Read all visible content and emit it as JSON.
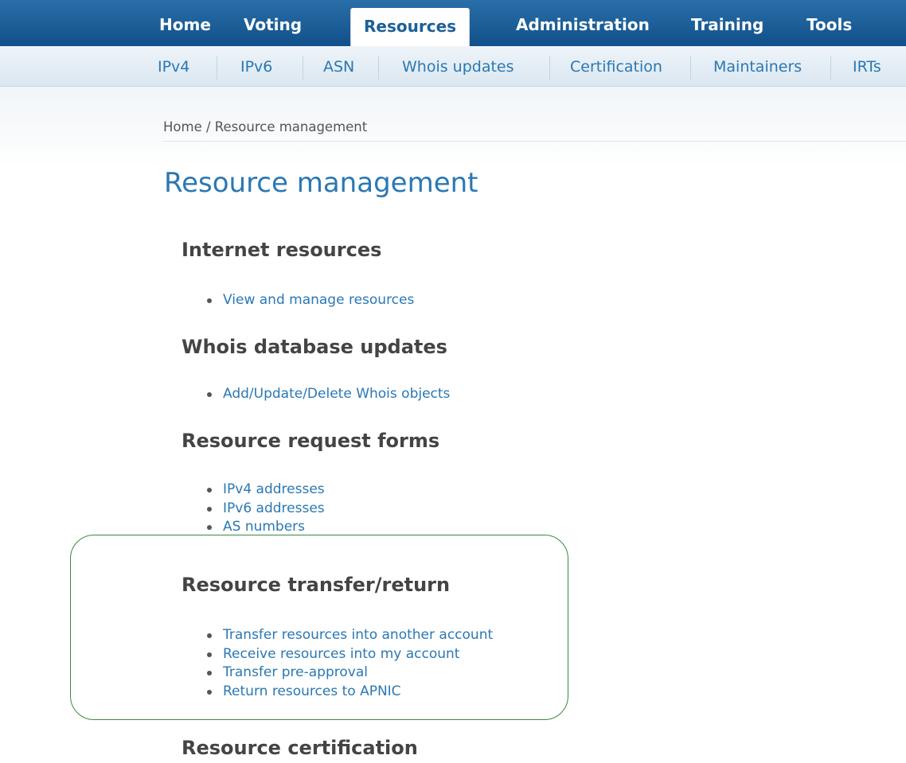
{
  "topnav": {
    "items": [
      {
        "label": "Home"
      },
      {
        "label": "Voting"
      },
      {
        "label": "Resources"
      },
      {
        "label": "Administration"
      },
      {
        "label": "Training"
      },
      {
        "label": "Tools"
      }
    ],
    "active": "Resources"
  },
  "subnav": {
    "items": [
      {
        "label": "IPv4"
      },
      {
        "label": "IPv6"
      },
      {
        "label": "ASN"
      },
      {
        "label": "Whois updates"
      },
      {
        "label": "Certification"
      },
      {
        "label": "Maintainers"
      },
      {
        "label": "IRTs"
      }
    ]
  },
  "breadcrumb": {
    "home": "Home",
    "separator": " / ",
    "current": "Resource management"
  },
  "page": {
    "title": "Resource management"
  },
  "sections": [
    {
      "heading": "Internet resources",
      "links": [
        "View and manage resources"
      ]
    },
    {
      "heading": "Whois database updates",
      "links": [
        "Add/Update/Delete Whois objects"
      ]
    },
    {
      "heading": "Resource request forms",
      "links": [
        "IPv4 addresses",
        "IPv6 addresses",
        "AS numbers"
      ]
    },
    {
      "heading": "Resource transfer/return",
      "links": [
        "Transfer resources into another account",
        "Receive resources into my account",
        "Transfer pre-approval",
        "Return resources to APNIC"
      ]
    },
    {
      "heading": "Resource certification",
      "links": []
    }
  ],
  "colors": {
    "nav_blue": "#11508a",
    "link_blue": "#2a78b3",
    "heading_gray": "#444444",
    "highlight_green": "#3a8a3a"
  }
}
